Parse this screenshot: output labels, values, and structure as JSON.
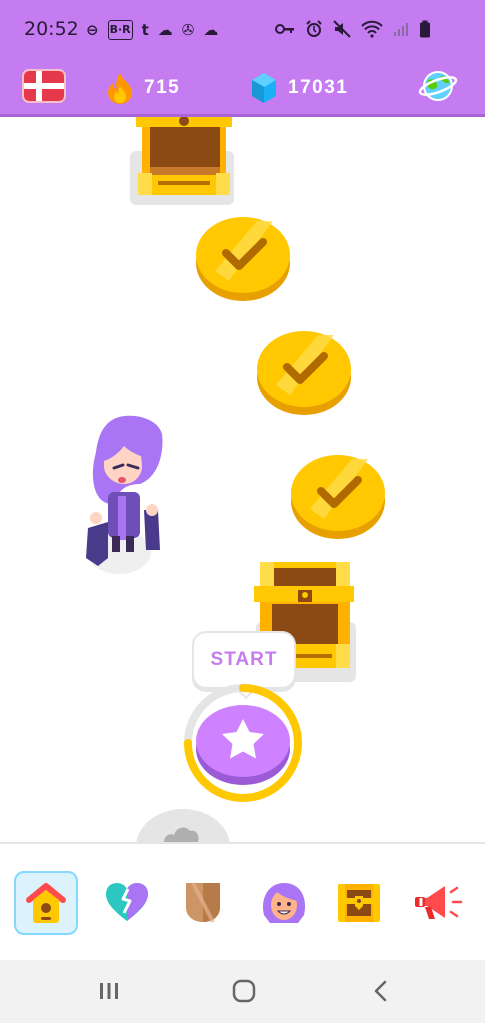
{
  "status_bar": {
    "time": "20:52",
    "left_icons": [
      "dnd-icon",
      "br-app-icon",
      "tumblr-icon",
      "cloud-icon",
      "fan-icon",
      "cloud-icon"
    ],
    "left_glyphs": [
      "⊖",
      "B·R",
      "t",
      "☁",
      "✇",
      "☁"
    ],
    "right_icons": [
      "key-icon",
      "alarm-icon",
      "mute-icon",
      "wifi-icon",
      "signal-icon",
      "battery-icon"
    ]
  },
  "header": {
    "course_flag": "denmark-flag-icon",
    "streak_count": "715",
    "gems_count": "17031",
    "colors": {
      "bar": "#c57cf0",
      "flame": "#ff9600",
      "gem": "#1cb0f6"
    }
  },
  "path": {
    "start_label": "START",
    "nodes": [
      {
        "type": "chest",
        "state": "opened"
      },
      {
        "type": "lesson",
        "state": "completed"
      },
      {
        "type": "lesson",
        "state": "completed"
      },
      {
        "type": "lesson",
        "state": "completed"
      },
      {
        "type": "chest",
        "state": "opened"
      },
      {
        "type": "lesson",
        "state": "current"
      },
      {
        "type": "lesson",
        "state": "locked"
      }
    ],
    "character": "lily-character"
  },
  "bottom_nav": {
    "items": [
      {
        "name": "home",
        "icon": "birdhouse-icon",
        "active": true
      },
      {
        "name": "practice",
        "icon": "heart-icon",
        "active": false
      },
      {
        "name": "leagues",
        "icon": "shield-icon",
        "active": false
      },
      {
        "name": "profile",
        "icon": "avatar-icon",
        "active": false
      },
      {
        "name": "shop",
        "icon": "treasure-chest-icon",
        "active": false
      },
      {
        "name": "news",
        "icon": "megaphone-icon",
        "active": false
      }
    ]
  },
  "system_nav": [
    "recent-apps-icon",
    "home-circle-icon",
    "back-icon"
  ]
}
